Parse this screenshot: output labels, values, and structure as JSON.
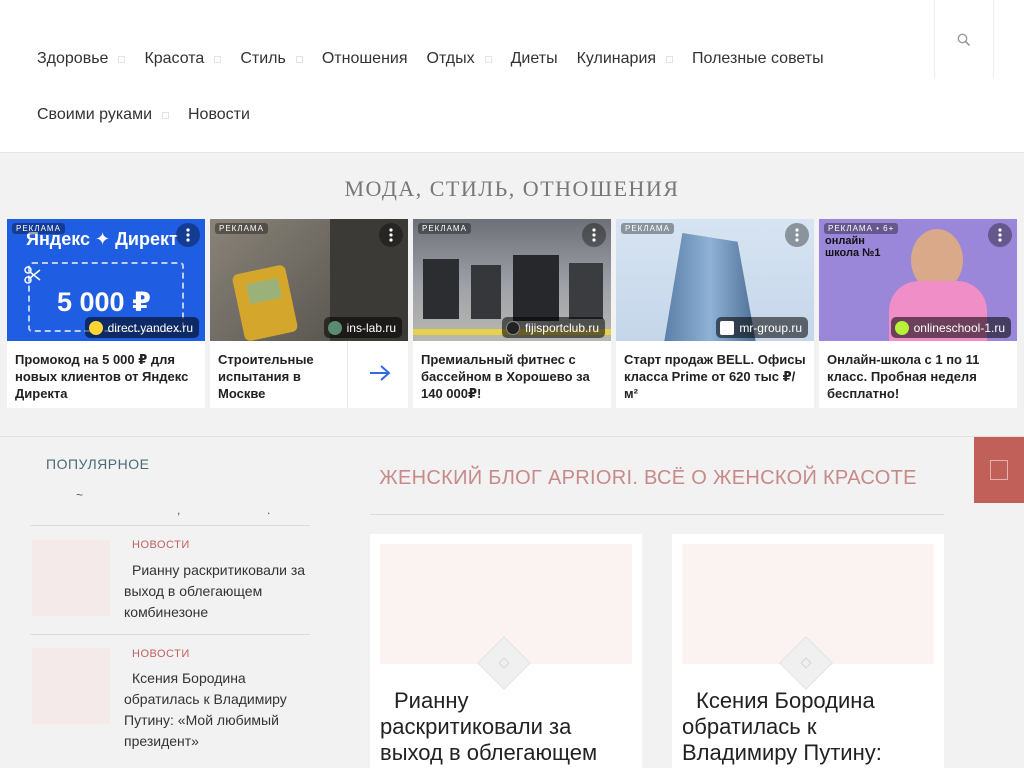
{
  "nav": {
    "row1": [
      {
        "label": "Здоровье",
        "dropdown": true
      },
      {
        "label": "Красота",
        "dropdown": true
      },
      {
        "label": "Стиль",
        "dropdown": true
      },
      {
        "label": "Отношения",
        "dropdown": false
      },
      {
        "label": "Отдых",
        "dropdown": true
      },
      {
        "label": "Диеты",
        "dropdown": false
      },
      {
        "label": "Кулинария",
        "dropdown": true
      },
      {
        "label": "Полезные советы",
        "dropdown": false
      }
    ],
    "row2": [
      {
        "label": "Своими руками",
        "dropdown": true
      },
      {
        "label": "Новости",
        "dropdown": false
      }
    ],
    "search_icon": "search-icon"
  },
  "section_title": "МОДА, СТИЛЬ, ОТНОШЕНИЯ",
  "ads": [
    {
      "label": "РЕКЛАМА",
      "domain": "direct.yandex.ru",
      "desc": "Промокод на 5 000 ₽ для новых клиентов от Яндекс Директа",
      "brand": "Яндекс ✦ Директ",
      "amount": "5 000 ₽"
    },
    {
      "label": "РЕКЛАМА",
      "domain": "ins-lab.ru",
      "desc": "Строительные испытания в Москве"
    },
    {
      "label": "РЕКЛАМА",
      "domain": "fijisportclub.ru",
      "desc": "Премиальный фитнес с бассейном в Хорошево за 140 000₽!"
    },
    {
      "label": "РЕКЛАМА",
      "domain": "mr-group.ru",
      "desc": "Старт продаж BELL. Офисы класса Prime от 620 тыс ₽/м²"
    },
    {
      "label": "РЕКЛАМА • 6+",
      "domain": "onlineschool-1.ru",
      "desc": "Онлайн-школа с 1 по 11 класс. Пробная неделя бесплатно!",
      "overlay": "онлайн школа №1"
    }
  ],
  "sidebar": {
    "title": "ПОПУЛЯРНОЕ",
    "stray": [
      "~",
      ",",
      "."
    ],
    "items": [
      {
        "category": "НОВОСТИ",
        "text": "Рианну раскритиковали за выход в облегающем комбинезоне"
      },
      {
        "category": "НОВОСТИ",
        "text": "Ксения Бородина обратилась к Владимиру Путину: «Мой любимый президент»"
      }
    ]
  },
  "main": {
    "title": "ЖЕНСКИЙ БЛОГ APRIORI. ВСЁ О ЖЕНСКОЙ КРАСОТЕ",
    "cards": [
      {
        "title": "Рианну раскритиковали за выход в облегающем"
      },
      {
        "title": "Ксения Бородина обратилась к Владимиру Путину:"
      }
    ]
  },
  "colors": {
    "accent": "#c16058",
    "title_pink": "#c7898a",
    "category": "#c0625f"
  }
}
